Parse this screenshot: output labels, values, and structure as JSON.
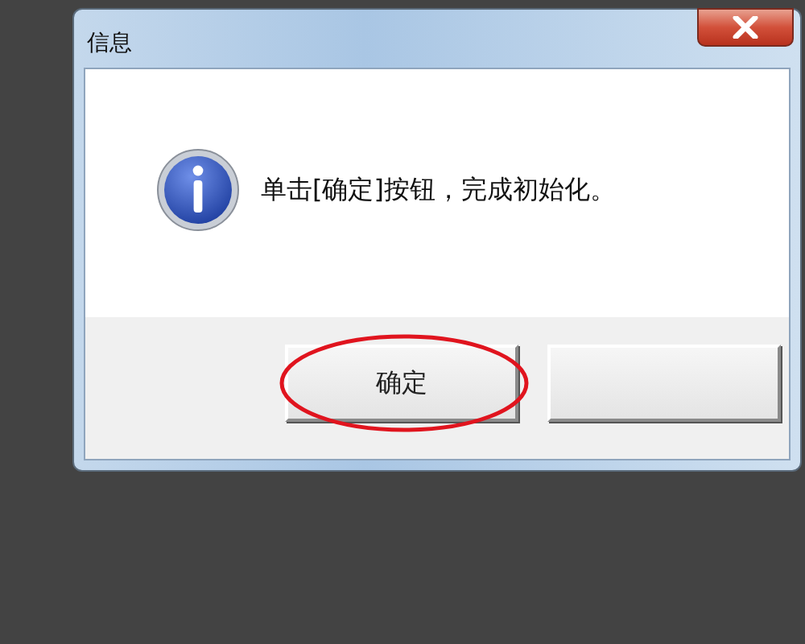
{
  "window": {
    "title": "信息"
  },
  "message": "单击[确定]按钮，完成初始化。",
  "buttons": [
    {
      "label": "确定",
      "highlighted": true
    },
    {
      "highlighted": false
    }
  ]
}
